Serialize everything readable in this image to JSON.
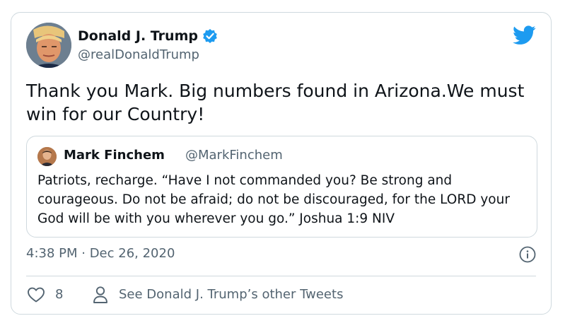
{
  "tweet": {
    "author_name": "Donald J. Trump",
    "author_handle": "@realDonaldTrump",
    "text": "Thank you Mark. Big numbers found in Arizona.We must win for our Country!",
    "timestamp": "4:38 PM · Dec 26, 2020",
    "likes": "8",
    "other_tweets_link": "See Donald J. Trump’s other Tweets"
  },
  "quoted": {
    "author_name": "Mark Finchem",
    "author_handle": "@MarkFinchem",
    "text": "Patriots, recharge. “Have I not commanded you? Be strong and courageous. Do not be afraid; do not be discouraged, for the LORD your God will be with you wherever you go.” Joshua 1:9 NIV"
  },
  "icons": {
    "verified": "verified-badge-icon",
    "logo": "twitter-bird-icon",
    "info": "info-icon",
    "like": "heart-icon",
    "profile": "person-icon"
  },
  "colors": {
    "brand": "#1d9bf0",
    "text": "#0f1419",
    "secondary": "#536471",
    "border": "#cfd9de"
  }
}
